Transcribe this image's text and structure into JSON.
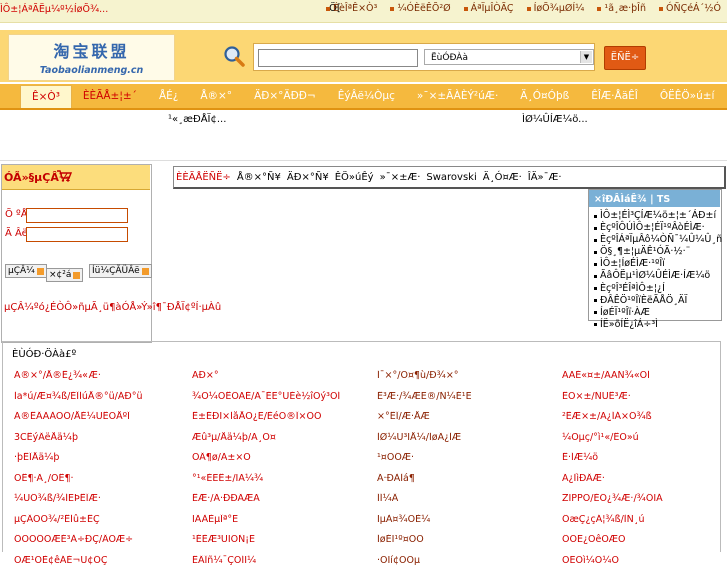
{
  "top_bar": {
    "link": "ÌÔ±¦ÁªÃËµ¼º½ÍøÕ¾...",
    "mid": "Ö[",
    "nav": [
      "ÉèÎªÊ×Ò³",
      "¼ÓÈëÊÕ²Ø",
      "ÁªÏµÎÒÃÇ",
      "ÍøÕ¾µØÍ¼",
      "¹ã¸æ·þÎñ",
      "ÓÑÇéÁ´½Ó"
    ]
  },
  "logo": {
    "cn": "淘宝联盟",
    "en": "Taobaolianmeng.cn"
  },
  "search": {
    "category": "ËùÓÐÀà",
    "button": "ËÑË÷"
  },
  "nav": [
    {
      "label": "Ê×Ò³",
      "state": "active"
    },
    {
      "label": "ÈÈÃÅ±¦±´",
      "state": "hl"
    },
    {
      "label": "ÅÉ¿",
      "state": ""
    },
    {
      "label": "Å®×°",
      "state": ""
    },
    {
      "label": "ÄÐ×°ÄÐÐ¬",
      "state": ""
    },
    {
      "label": "ÊýÂë¼Òµç",
      "state": ""
    },
    {
      "label": "»¯×±ÃÀÈÝ²úÆ·",
      "state": ""
    },
    {
      "label": "Ä¸Ó¤Óþß",
      "state": ""
    },
    {
      "label": "ÊÎÆ·ÅäÊÎ",
      "state": ""
    },
    {
      "label": "ÔËÊÖ»ú±í",
      "state": ""
    }
  ],
  "news": {
    "left": "¹«¸æÐÅÏ¢...",
    "right": "ÌØ¼ÛÍÆ¼ö..."
  },
  "login": {
    "title": "ÓÃ»§µÇÂ½",
    "field1": "Õ ºÅ",
    "field2": "Ã Âë",
    "btn_login": "µÇÂ¼",
    "btn_register": "×¢²á",
    "btn_forgot": "Íü¼ÇÃÜÂë",
    "note": "µÇÂ¼ºó¿ÉÒÔ»ñµÃ¸ü¶àÓÅ»Ý»î¶¯ÐÅÏ¢ºÍ·µÀû"
  },
  "links": [
    "ÈÈÃÅËÑË÷",
    "Å®×°Ñ¥",
    "ÄÐ×°Ñ¥",
    "ÊÖ»úÊý",
    "»¯×±Æ·",
    "Swarovski",
    "Ä¸Ó¤Æ·",
    "ÎÄ»¯Æ·"
  ],
  "tips": {
    "title": "×îÐÂÌáÊ¾ | TS",
    "items": [
      "ÌÔ±¦ÉÌ³ÇÍÆ¼ö±¦±´ÁÐ±í",
      "ÈçºÎÔÚÌÔ±¦ÉÏ¹ºÂòÉÌÆ·",
      "ÈçºÎÁªÏµÂô¼ÒÑ¯¼Û¼Û¸ñ",
      "Ö§¸¶±¦µÄÊ¹ÓÃ·½·¨",
      "ÌÔ±¦ÍøÉÌÆ·¹ºÎï",
      "ÃâÔËµ¹ÌØ¼ÛÉÌÆ·ÍÆ¼ö",
      "ÈçºÎ³ÉÎªÌÔ±¦¿Í",
      "ÐÂÊÖ¹ºÎïÈëÃÅÖ¸ÄÏ",
      "ÍøÉÏ¹ºÎï·ÀÆ­",
      "ÍË»õÍË¿îÁ÷³Ì"
    ]
  },
  "bottom": {
    "title": "ÈÙÓÐ·ÖÀà£º",
    "grid": [
      [
        "Ã®×°/Å®Ê¿¾«Æ·",
        "ÄÐ×°",
        "Í¯×°/Ó¤¶ù/Ð¾×°",
        "ÃÄÉ«¤±/ÃÄÑ¾«ÖÍ"
      ],
      [
        "Ìa*ú/Æ¤¾ß/ÉÎÍúÅ®°ü/ÁÐ°ü",
        "¾Ó¼ÒÊÕÄÉ/Ã¯ÈË°ÚÉè½îÓý³ÔÍ",
        "Ê³Æ·/¾ÆË®/Ñ¼É¹Ë",
        "ÊÖ×±/ÑÜÊ³Æ·"
      ],
      [
        "Ã®ÊÂÃÀÒÕ/ÅÉ¼ÜÊÒÅºÎ",
        "Ê±ÉÐÏ×ÌåÅÔ¿Ë/ÈéÔ®Î×ÕÕ",
        "×°ÊÎ/Æ·ÅÆ",
        "²ÊÆ×±/Ä¿ÍÁ×Õ¾ß"
      ],
      [
        "3CÊýÂëÅä¼þ",
        "Æû³µ/Åä¼þ/Ä¸Ó¤",
        "ÌØ¼Û³ÏÅ¼/ÍøÃ¿ÌÆ",
        "¼Òµç/°ì¹«/ÊÖ»ú"
      ],
      [
        "·þÊÎÅä¼þ",
        "ÒÂ¶ø/Ã±×Ó",
        "¹¤ÒÕÆ·",
        "Ê·ÍÆ¼ö"
      ],
      [
        "ÒÊ¶·Ã¸/ÒÊ¶·",
        "°¹«ÈËÊ±/ÏÄ¼¾",
        "Ã·ÐÀÌá¶",
        "Ã¿ÌìÐÂÆ·"
      ],
      [
        "¼ÙÕ¾ß/¾ÍËÞÊÎÆ·",
        "ÊÆ·/Ã·ÐÐÃÆÄ",
        "ÍÍ¼Â",
        "ZIPPO/ÈÕ¿¾Æ·/¾ÕÏÁ"
      ],
      [
        "µÇÂÔÖ¾/²ÊÍû±ÊÇ",
        "ÏÃÀÈµÎª°Ë",
        "ÏµÀ¤¾ÓÈ¼",
        "ÕæÇ¿çÁ¦¾ß/ÌÑ¸ú"
      ],
      [
        "ÕÓÒÕÔÆÉ³À÷ÐÇ/ÂÖÆ÷",
        "¹ÉÈÆ³ÚÏÖÑ¡Ë",
        "ÍøÉÏ¹º¤ÖÒ",
        "ÕÒË¿ÓêÖÆÔ"
      ],
      [
        "ÖÆ¹ÔÈ¢êÁÉ¬Ú¢ÕÇ",
        "ÊÂÎñ¼¯ÇÓÍÏ¼",
        "·ÖÏí¢ÖÔµ",
        "ÔËÔì¼Ó¼Ö"
      ]
    ]
  },
  "colors": {
    "nav_bg": "#f5b93e",
    "header_bg": "#fcd774",
    "accent_red": "#d00000",
    "tips_head": "#7ab0d6"
  }
}
